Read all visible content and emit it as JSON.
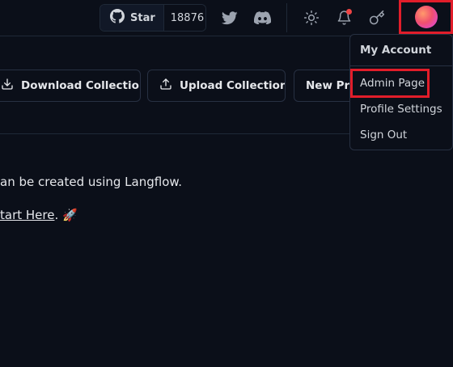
{
  "header": {
    "star_label": "Star",
    "star_count": "18876",
    "icons": [
      "github-icon",
      "twitter-icon",
      "discord-icon",
      "sun-icon",
      "bell-icon",
      "key-icon"
    ],
    "notification_dot_color": "#ef4444"
  },
  "toolbar": {
    "download_label": "Download Collection",
    "upload_label": "Upload Collection",
    "new_label": "New Pro"
  },
  "main": {
    "line1": "an be created using Langflow.",
    "line2_link": "tart Here",
    "line2_rest": ". 🚀"
  },
  "menu": {
    "title": "My Account",
    "items": [
      "Admin Page",
      "Profile Settings",
      "Sign Out"
    ]
  },
  "colors": {
    "background": "#0b0f19",
    "highlight_border": "#e11d2a"
  }
}
